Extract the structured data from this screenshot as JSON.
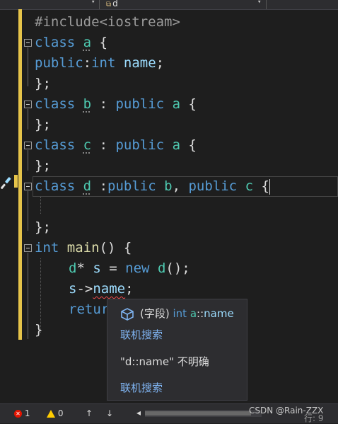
{
  "nav": {
    "member_icon": "",
    "member_name": "d"
  },
  "code": {
    "l1": "#include<iostream>",
    "l2": [
      "class",
      "a",
      "{"
    ],
    "l3": [
      "public",
      ":",
      "int",
      "name",
      ";"
    ],
    "l4": "};",
    "l5": [
      "class",
      "b",
      ":",
      "public",
      "a",
      "{"
    ],
    "l6": "};",
    "l7": [
      "class",
      "c",
      ":",
      "public",
      "a",
      "{"
    ],
    "l8": "};",
    "l9": [
      "class",
      "d",
      ":",
      "public",
      "b",
      ",",
      "public",
      "c",
      "{"
    ],
    "l11": "};",
    "l12": [
      "int",
      "main",
      "()",
      "{"
    ],
    "l13": [
      "d",
      "*",
      "s",
      "=",
      "new",
      "d",
      "();"
    ],
    "l14": [
      "s",
      "->",
      "name",
      ";"
    ],
    "l15": "retur",
    "l16": "}"
  },
  "tooltip": {
    "kind": "(字段)",
    "type": "int",
    "scope": "a",
    "sep": "::",
    "member": "name",
    "link1": "联机搜索",
    "message": "\"d::name\" 不明确",
    "link2": "联机搜索"
  },
  "status": {
    "errors": "1",
    "warnings": "0",
    "up_arrow": "↑",
    "down_arrow": "↓",
    "left_arrow": "◂",
    "line_label": "行: 9"
  },
  "watermark": "CSDN @Rain-ZZX",
  "colors": {
    "keyword": "#569cd6",
    "type_name": "#4ec9b0",
    "variable": "#9cdcfe",
    "function": "#dcdcaa",
    "error": "#e51400",
    "warning": "#ffcc00",
    "link": "#7fb3f0",
    "modified_marker": "#e6c44a"
  }
}
